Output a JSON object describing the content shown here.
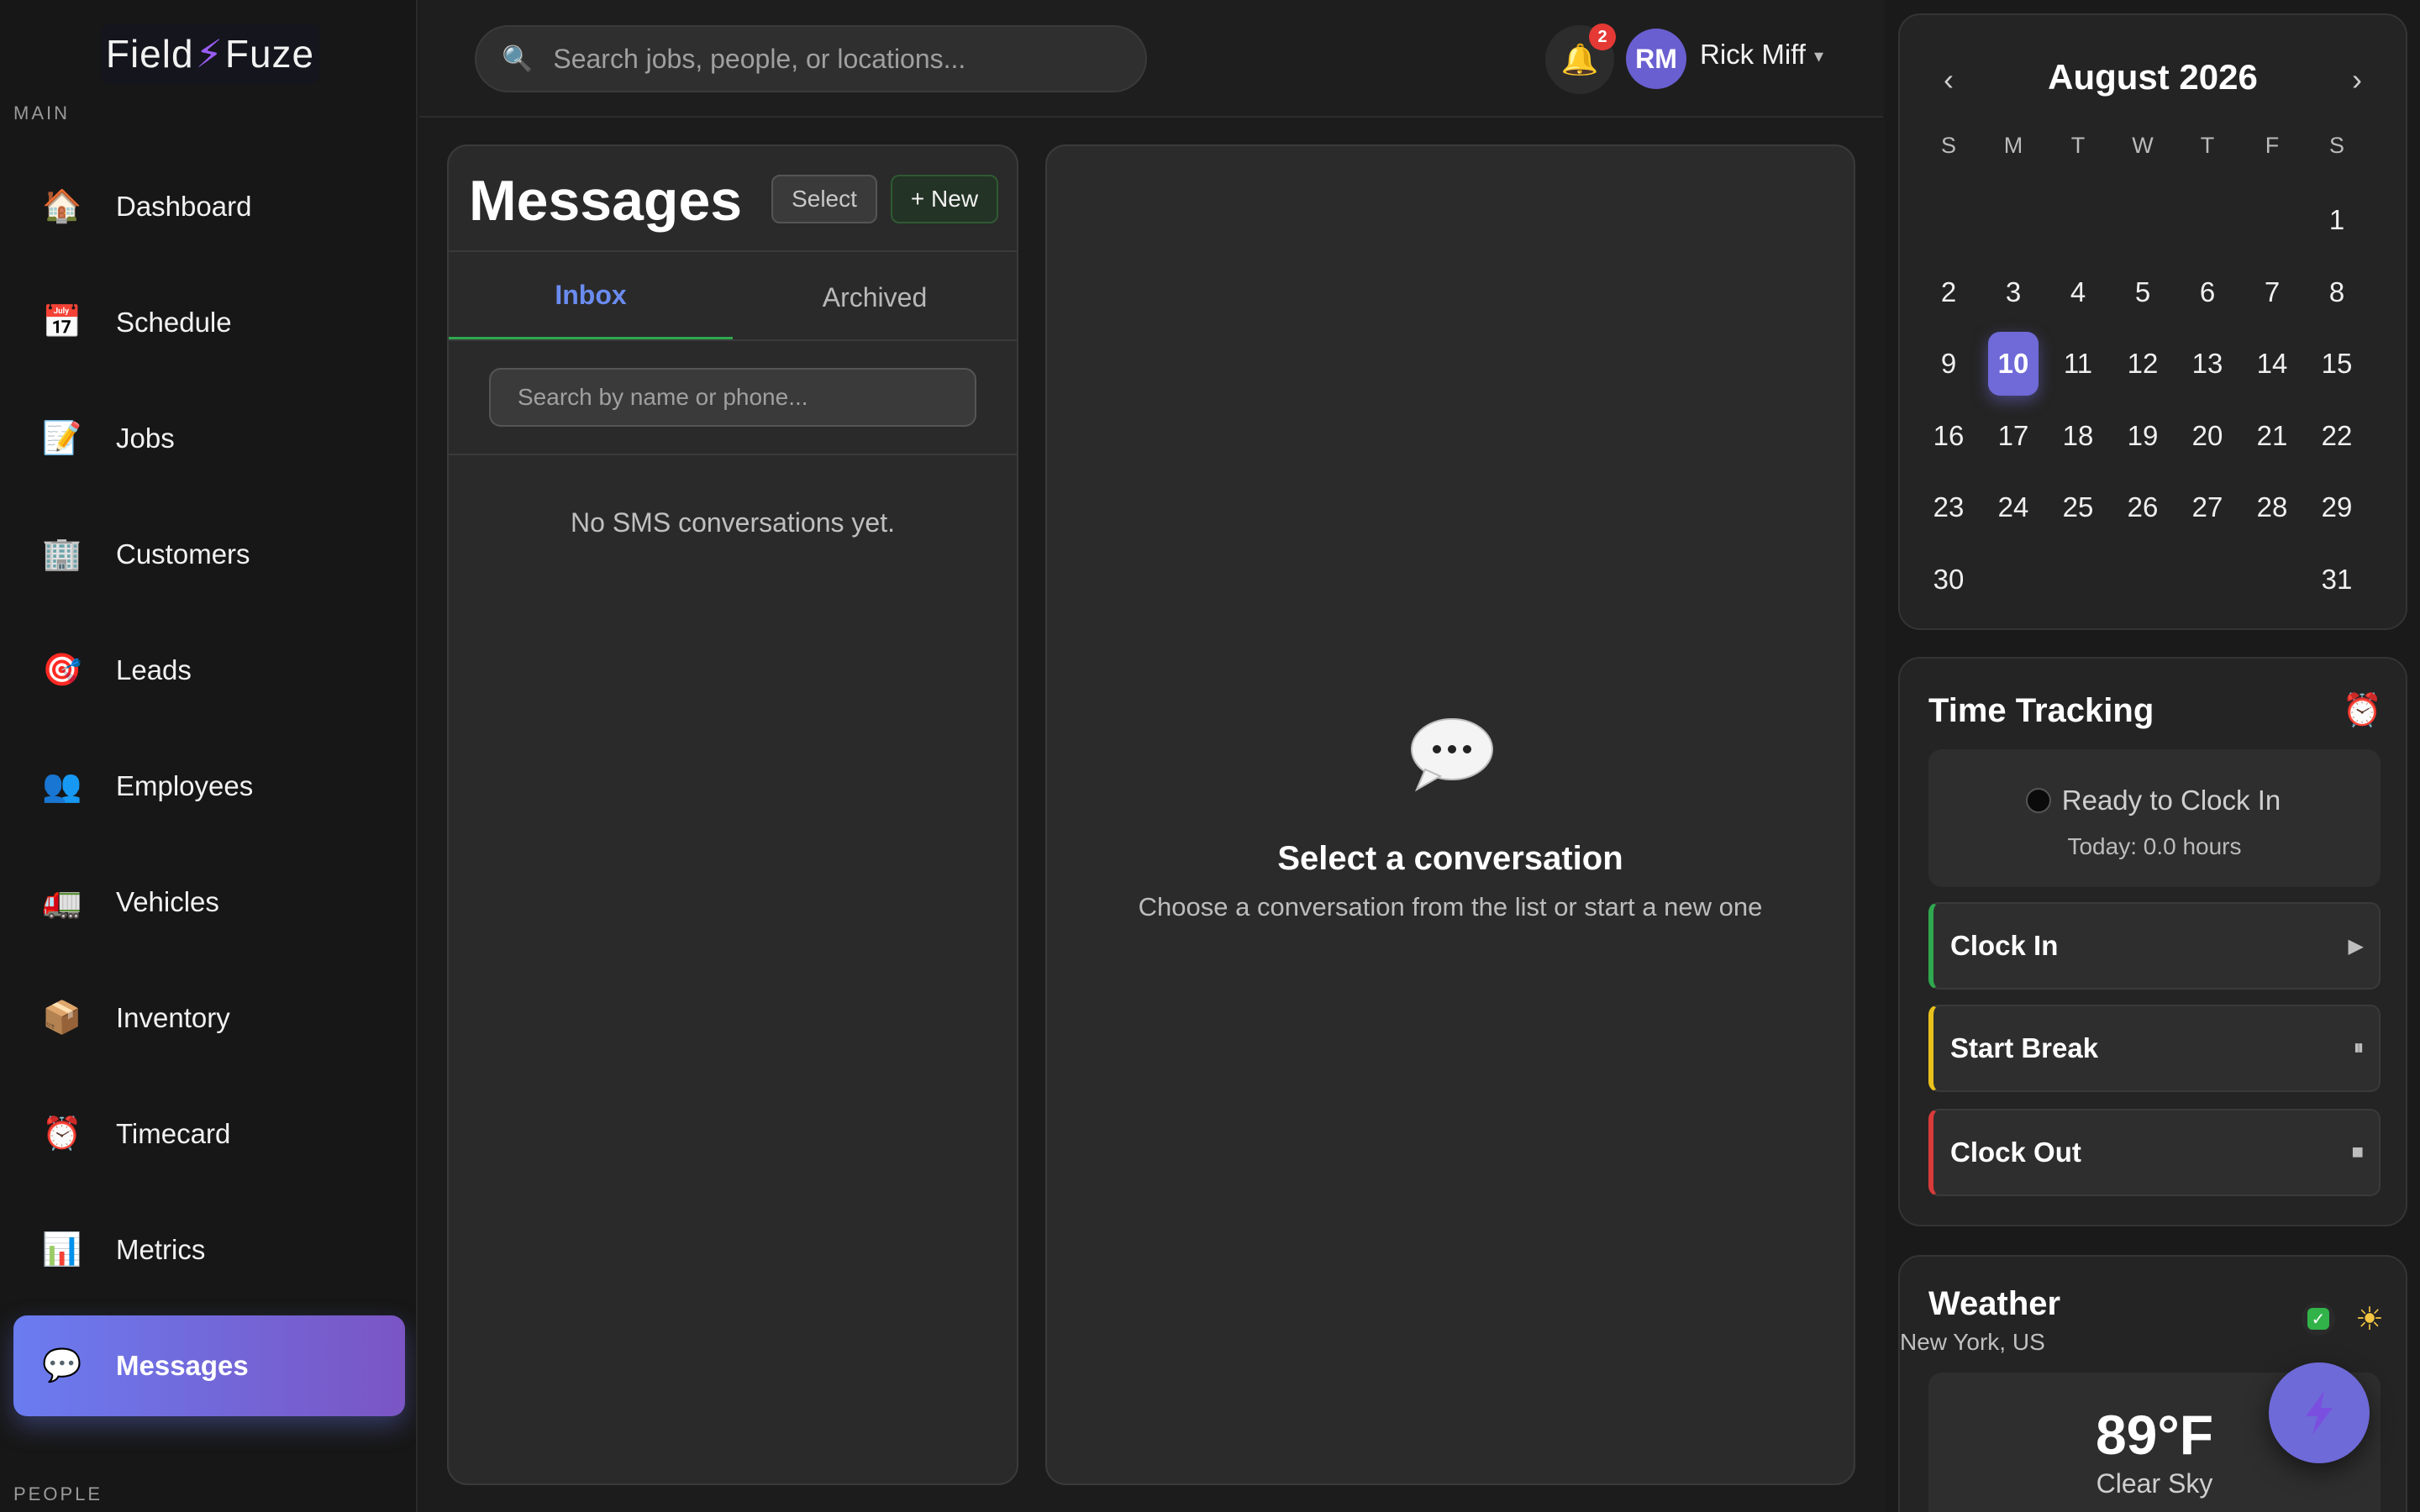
{
  "brand": {
    "left": "Field",
    "bolt": "⚡",
    "right": "Fuze"
  },
  "sidebar": {
    "section_main": "MAIN",
    "section_people": "PEOPLE",
    "items": [
      {
        "label": "Dashboard",
        "icon": "🏠",
        "icon_name": "house-icon"
      },
      {
        "label": "Schedule",
        "icon": "📅",
        "icon_name": "calendar-icon"
      },
      {
        "label": "Jobs",
        "icon": "📝",
        "icon_name": "memo-icon"
      },
      {
        "label": "Customers",
        "icon": "🏢",
        "icon_name": "building-icon"
      },
      {
        "label": "Leads",
        "icon": "🎯",
        "icon_name": "target-icon"
      },
      {
        "label": "Employees",
        "icon": "👥",
        "icon_name": "people-icon"
      },
      {
        "label": "Vehicles",
        "icon": "🚛",
        "icon_name": "truck-icon"
      },
      {
        "label": "Inventory",
        "icon": "📦",
        "icon_name": "box-icon"
      },
      {
        "label": "Timecard",
        "icon": "⏰",
        "icon_name": "alarm-clock-icon"
      },
      {
        "label": "Metrics",
        "icon": "📊",
        "icon_name": "bar-chart-icon"
      },
      {
        "label": "Messages",
        "icon": "💬",
        "icon_name": "speech-bubble-icon",
        "active": true
      }
    ]
  },
  "topbar": {
    "search_placeholder": "Search jobs, people, or locations...",
    "notifications_count": "2",
    "user_initials": "RM",
    "user_name": "Rick Miff",
    "caret": "▾"
  },
  "messages": {
    "title": "Messages",
    "select_label": "Select",
    "new_label": "+ New",
    "tabs": [
      {
        "label": "Inbox",
        "active": true
      },
      {
        "label": "Archived",
        "active": false
      }
    ],
    "search_placeholder": "Search by name or phone...",
    "empty_text": "No SMS conversations yet."
  },
  "conversation": {
    "title": "Select a conversation",
    "subtitle": "Choose a conversation from the list or start a new one"
  },
  "calendar": {
    "month_label": "August 2026",
    "prev": "‹",
    "next": "›",
    "weekdays": [
      "S",
      "M",
      "T",
      "W",
      "T",
      "F",
      "S"
    ],
    "first_weekday_index": 6,
    "days_in_month": 31,
    "today": 10
  },
  "time_tracking": {
    "title": "Time Tracking",
    "status": "Ready to Clock In",
    "today_hours": "Today: 0.0 hours",
    "buttons": [
      {
        "label": "Clock In",
        "action_icon": "▶",
        "accent": "#2fa84f"
      },
      {
        "label": "Start Break",
        "action_icon": "⏸",
        "accent": "#e8c11c"
      },
      {
        "label": "Clock Out",
        "action_icon": "■",
        "accent": "#d93a3a"
      }
    ]
  },
  "weather": {
    "title": "Weather",
    "location": "New York, US",
    "temperature": "89°F",
    "condition": "Clear Sky"
  },
  "colors": {
    "accent": "#6f6ad8",
    "active_nav_gradient_start": "#6a7cf0",
    "active_nav_gradient_end": "#7b55c4",
    "inbox_tab_text": "#6a8cf0",
    "inbox_tab_underline": "#2fa84f"
  }
}
